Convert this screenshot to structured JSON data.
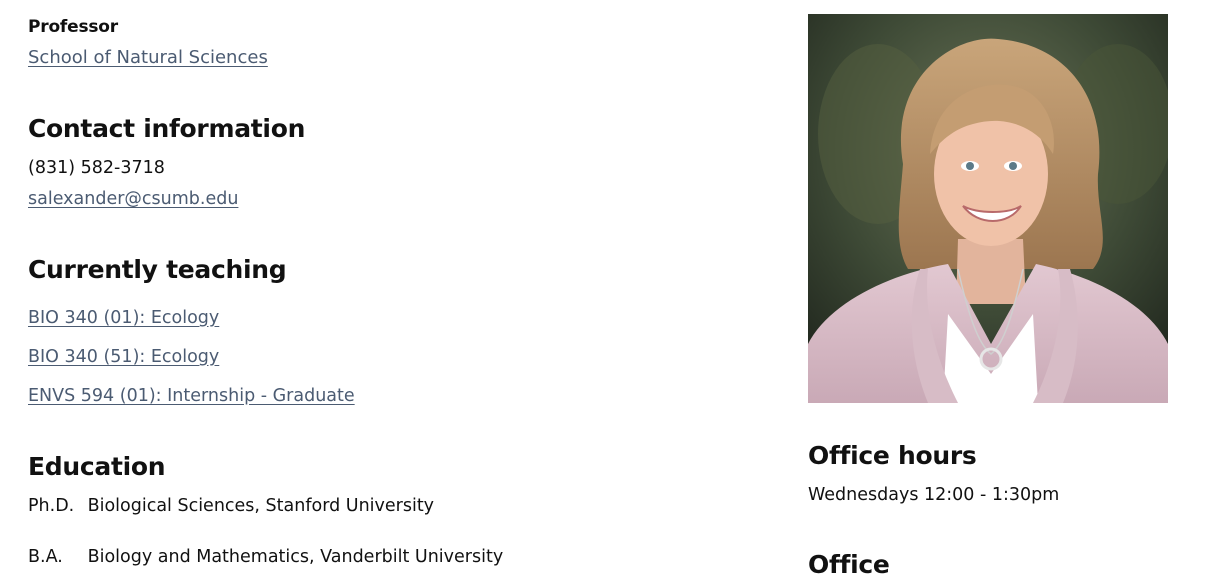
{
  "profile": {
    "title": "Professor",
    "department": "School of Natural Sciences"
  },
  "contact": {
    "heading": "Contact information",
    "phone": "(831) 582-3718",
    "email": "salexander@csumb.edu"
  },
  "teaching": {
    "heading": "Currently teaching",
    "courses": [
      "BIO 340 (01): Ecology",
      "BIO 340 (51): Ecology",
      "ENVS 594 (01): Internship - Graduate"
    ]
  },
  "education": {
    "heading": "Education",
    "items": [
      {
        "degree": "Ph.D.",
        "detail": "Biological Sciences, Stanford University"
      },
      {
        "degree": "B.A.",
        "detail": "Biology and Mathematics, Vanderbilt University"
      }
    ]
  },
  "office_hours": {
    "heading": "Office hours",
    "text": "Wednesdays 12:00 - 1:30pm"
  },
  "office": {
    "heading": "Office"
  },
  "photo": {
    "subject": "portrait-photo"
  }
}
